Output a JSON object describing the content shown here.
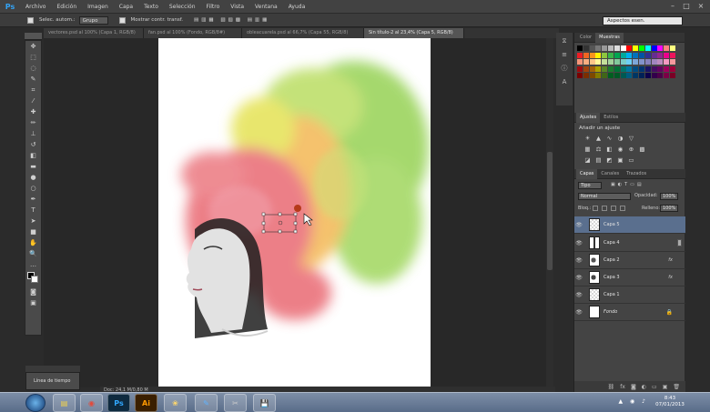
{
  "menu": [
    "Archivo",
    "Edición",
    "Imagen",
    "Capa",
    "Texto",
    "Selección",
    "Filtro",
    "Vista",
    "Ventana",
    "Ayuda"
  ],
  "options": {
    "auto_select_label": "Selec. autom.:",
    "auto_select_value": "Grupo",
    "transform_label": "Mostrar contr. transf."
  },
  "workspace": "Aspectos esen.",
  "tabs": [
    "vectores.psd al 100% (Capa 1, RGB/8)",
    "fan.psd al 100% (Fondo, RGB/8#)",
    "obleacuarela.psd al 66,7% (Capa 55, RGB/8)",
    "Sin título-2 al 23,4% (Capa 5, RGB/8)"
  ],
  "status": "Doc: 24,1 M/0,80 M",
  "history_label": "Línea de tiempo",
  "panels": {
    "swatch_tabs": [
      "Color",
      "Muestras"
    ],
    "adjust_tabs": [
      "Ajustes",
      "Estilos"
    ],
    "adjust_title": "Añadir un ajuste",
    "layer_tabs": [
      "Capas",
      "Canales",
      "Trazados"
    ],
    "filter_label": "Tipo",
    "blend_mode": "Normal",
    "opacity_label": "Opacidad:",
    "opacity_value": "100%",
    "lock_label": "Bloq.:",
    "fill_label": "Relleno:",
    "fill_value": "100%"
  },
  "layers": [
    {
      "name": "Capa 5",
      "active": true
    },
    {
      "name": "Capa 4",
      "active": false
    },
    {
      "name": "Capa 2",
      "active": false
    },
    {
      "name": "Capa 3",
      "active": false
    },
    {
      "name": "Capa 1",
      "active": false
    },
    {
      "name": "Fondo",
      "active": false
    }
  ],
  "taskbar": {
    "apps": [
      "explorer",
      "chrome",
      "photoshop",
      "illustrator",
      "folder",
      "paint",
      "other",
      "other2",
      "save"
    ],
    "time": "8:43",
    "date": "07/01/2013"
  },
  "colors": {
    "red": "#e8616b",
    "orange": "#f3b34a",
    "yellow": "#e3e14a",
    "green": "#8fcf4a"
  }
}
